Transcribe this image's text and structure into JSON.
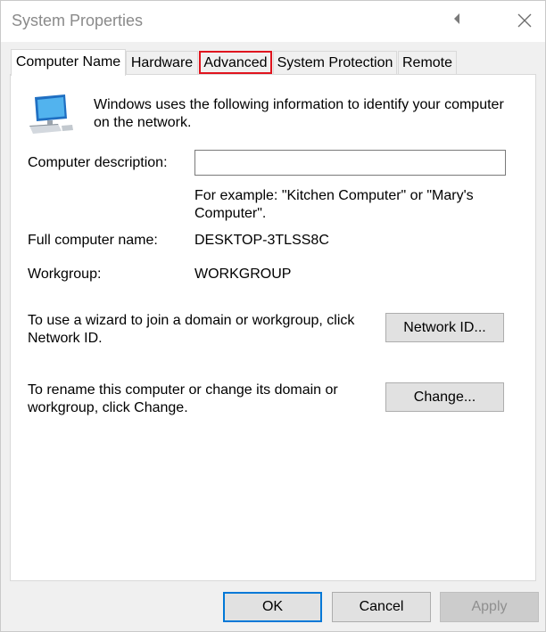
{
  "window": {
    "title": "System Properties"
  },
  "tabs": [
    {
      "label": "Computer Name",
      "active": true
    },
    {
      "label": "Hardware",
      "active": false
    },
    {
      "label": "Advanced",
      "active": false,
      "highlighted": true
    },
    {
      "label": "System Protection",
      "active": false
    },
    {
      "label": "Remote",
      "active": false
    }
  ],
  "panel": {
    "intro": "Windows uses the following information to identify your computer on the network.",
    "description_label": "Computer description:",
    "description_value": "",
    "example_text": "For example: \"Kitchen Computer\" or \"Mary's Computer\".",
    "full_name_label": "Full computer name:",
    "full_name_value": "DESKTOP-3TLSS8C",
    "workgroup_label": "Workgroup:",
    "workgroup_value": "WORKGROUP",
    "network_id_text": "To use a wizard to join a domain or workgroup, click Network ID.",
    "network_id_button": "Network ID...",
    "change_text": "To rename this computer or change its domain or workgroup, click Change.",
    "change_button": "Change..."
  },
  "footer": {
    "ok": "OK",
    "cancel": "Cancel",
    "apply": "Apply"
  },
  "icons": {
    "computer": "computer-icon",
    "help": "help-icon",
    "close": "close-icon"
  },
  "colors": {
    "highlight_border": "#e0141e",
    "default_button_border": "#0078d7"
  }
}
